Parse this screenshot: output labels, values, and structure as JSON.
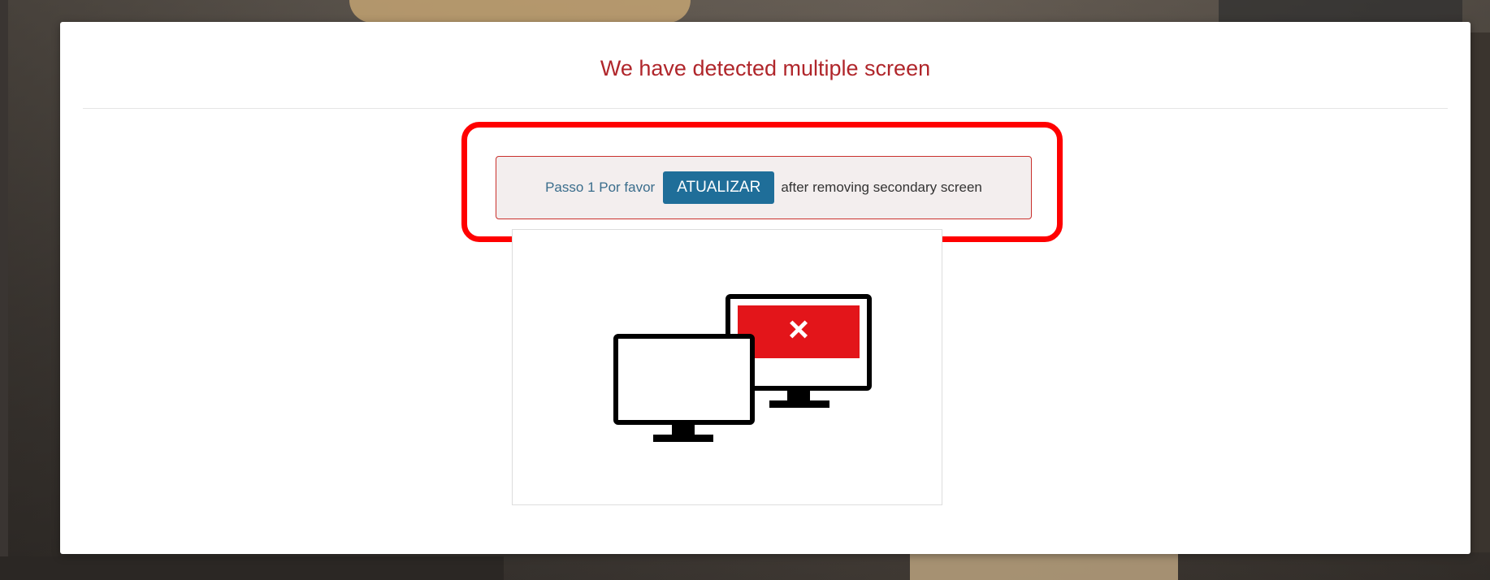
{
  "dialog": {
    "title": "We have detected multiple screen",
    "alert": {
      "step_text": "Passo 1 Por favor",
      "button_label": "ATUALIZAR",
      "after_text": "after removing secondary screen"
    },
    "illustration": {
      "icon": "multiple-monitors-error-icon",
      "error_mark": "×"
    }
  },
  "colors": {
    "title": "#b0262b",
    "highlight": "#ff0000",
    "button": "#1f6e99",
    "error_screen": "#e3151a"
  }
}
